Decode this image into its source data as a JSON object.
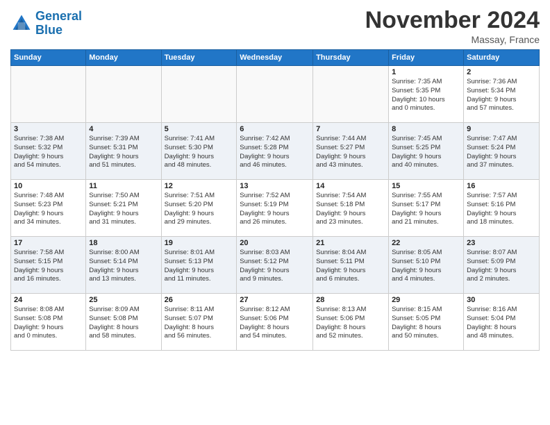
{
  "header": {
    "logo_line1": "General",
    "logo_line2": "Blue",
    "month": "November 2024",
    "location": "Massay, France"
  },
  "days_of_week": [
    "Sunday",
    "Monday",
    "Tuesday",
    "Wednesday",
    "Thursday",
    "Friday",
    "Saturday"
  ],
  "weeks": [
    [
      {
        "num": "",
        "info": ""
      },
      {
        "num": "",
        "info": ""
      },
      {
        "num": "",
        "info": ""
      },
      {
        "num": "",
        "info": ""
      },
      {
        "num": "",
        "info": ""
      },
      {
        "num": "1",
        "info": "Sunrise: 7:35 AM\nSunset: 5:35 PM\nDaylight: 10 hours\nand 0 minutes."
      },
      {
        "num": "2",
        "info": "Sunrise: 7:36 AM\nSunset: 5:34 PM\nDaylight: 9 hours\nand 57 minutes."
      }
    ],
    [
      {
        "num": "3",
        "info": "Sunrise: 7:38 AM\nSunset: 5:32 PM\nDaylight: 9 hours\nand 54 minutes."
      },
      {
        "num": "4",
        "info": "Sunrise: 7:39 AM\nSunset: 5:31 PM\nDaylight: 9 hours\nand 51 minutes."
      },
      {
        "num": "5",
        "info": "Sunrise: 7:41 AM\nSunset: 5:30 PM\nDaylight: 9 hours\nand 48 minutes."
      },
      {
        "num": "6",
        "info": "Sunrise: 7:42 AM\nSunset: 5:28 PM\nDaylight: 9 hours\nand 46 minutes."
      },
      {
        "num": "7",
        "info": "Sunrise: 7:44 AM\nSunset: 5:27 PM\nDaylight: 9 hours\nand 43 minutes."
      },
      {
        "num": "8",
        "info": "Sunrise: 7:45 AM\nSunset: 5:25 PM\nDaylight: 9 hours\nand 40 minutes."
      },
      {
        "num": "9",
        "info": "Sunrise: 7:47 AM\nSunset: 5:24 PM\nDaylight: 9 hours\nand 37 minutes."
      }
    ],
    [
      {
        "num": "10",
        "info": "Sunrise: 7:48 AM\nSunset: 5:23 PM\nDaylight: 9 hours\nand 34 minutes."
      },
      {
        "num": "11",
        "info": "Sunrise: 7:50 AM\nSunset: 5:21 PM\nDaylight: 9 hours\nand 31 minutes."
      },
      {
        "num": "12",
        "info": "Sunrise: 7:51 AM\nSunset: 5:20 PM\nDaylight: 9 hours\nand 29 minutes."
      },
      {
        "num": "13",
        "info": "Sunrise: 7:52 AM\nSunset: 5:19 PM\nDaylight: 9 hours\nand 26 minutes."
      },
      {
        "num": "14",
        "info": "Sunrise: 7:54 AM\nSunset: 5:18 PM\nDaylight: 9 hours\nand 23 minutes."
      },
      {
        "num": "15",
        "info": "Sunrise: 7:55 AM\nSunset: 5:17 PM\nDaylight: 9 hours\nand 21 minutes."
      },
      {
        "num": "16",
        "info": "Sunrise: 7:57 AM\nSunset: 5:16 PM\nDaylight: 9 hours\nand 18 minutes."
      }
    ],
    [
      {
        "num": "17",
        "info": "Sunrise: 7:58 AM\nSunset: 5:15 PM\nDaylight: 9 hours\nand 16 minutes."
      },
      {
        "num": "18",
        "info": "Sunrise: 8:00 AM\nSunset: 5:14 PM\nDaylight: 9 hours\nand 13 minutes."
      },
      {
        "num": "19",
        "info": "Sunrise: 8:01 AM\nSunset: 5:13 PM\nDaylight: 9 hours\nand 11 minutes."
      },
      {
        "num": "20",
        "info": "Sunrise: 8:03 AM\nSunset: 5:12 PM\nDaylight: 9 hours\nand 9 minutes."
      },
      {
        "num": "21",
        "info": "Sunrise: 8:04 AM\nSunset: 5:11 PM\nDaylight: 9 hours\nand 6 minutes."
      },
      {
        "num": "22",
        "info": "Sunrise: 8:05 AM\nSunset: 5:10 PM\nDaylight: 9 hours\nand 4 minutes."
      },
      {
        "num": "23",
        "info": "Sunrise: 8:07 AM\nSunset: 5:09 PM\nDaylight: 9 hours\nand 2 minutes."
      }
    ],
    [
      {
        "num": "24",
        "info": "Sunrise: 8:08 AM\nSunset: 5:08 PM\nDaylight: 9 hours\nand 0 minutes."
      },
      {
        "num": "25",
        "info": "Sunrise: 8:09 AM\nSunset: 5:08 PM\nDaylight: 8 hours\nand 58 minutes."
      },
      {
        "num": "26",
        "info": "Sunrise: 8:11 AM\nSunset: 5:07 PM\nDaylight: 8 hours\nand 56 minutes."
      },
      {
        "num": "27",
        "info": "Sunrise: 8:12 AM\nSunset: 5:06 PM\nDaylight: 8 hours\nand 54 minutes."
      },
      {
        "num": "28",
        "info": "Sunrise: 8:13 AM\nSunset: 5:06 PM\nDaylight: 8 hours\nand 52 minutes."
      },
      {
        "num": "29",
        "info": "Sunrise: 8:15 AM\nSunset: 5:05 PM\nDaylight: 8 hours\nand 50 minutes."
      },
      {
        "num": "30",
        "info": "Sunrise: 8:16 AM\nSunset: 5:04 PM\nDaylight: 8 hours\nand 48 minutes."
      }
    ]
  ]
}
